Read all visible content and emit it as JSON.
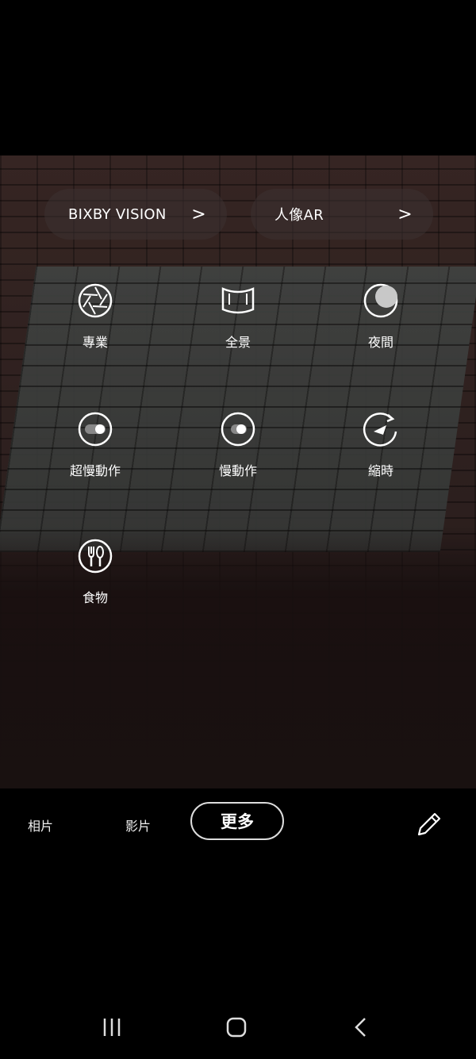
{
  "quick_links": [
    {
      "label": "BIXBY VISION",
      "chevron": ">"
    },
    {
      "label": "人像AR",
      "chevron": ">"
    }
  ],
  "modes": [
    {
      "label": "專業",
      "icon": "aperture-icon"
    },
    {
      "label": "全景",
      "icon": "panorama-icon"
    },
    {
      "label": "夜間",
      "icon": "moon-icon"
    },
    {
      "label": "超慢動作",
      "icon": "super-slow-motion-icon"
    },
    {
      "label": "慢動作",
      "icon": "slow-motion-icon"
    },
    {
      "label": "縮時",
      "icon": "hyperlapse-icon"
    },
    {
      "label": "食物",
      "icon": "food-icon"
    }
  ],
  "bottom_tabs": {
    "photo": "相片",
    "video": "影片",
    "more": "更多"
  },
  "edit_icon": "pencil-icon",
  "nav": {
    "recents": "recents-icon",
    "home": "home-icon",
    "back": "back-icon"
  }
}
